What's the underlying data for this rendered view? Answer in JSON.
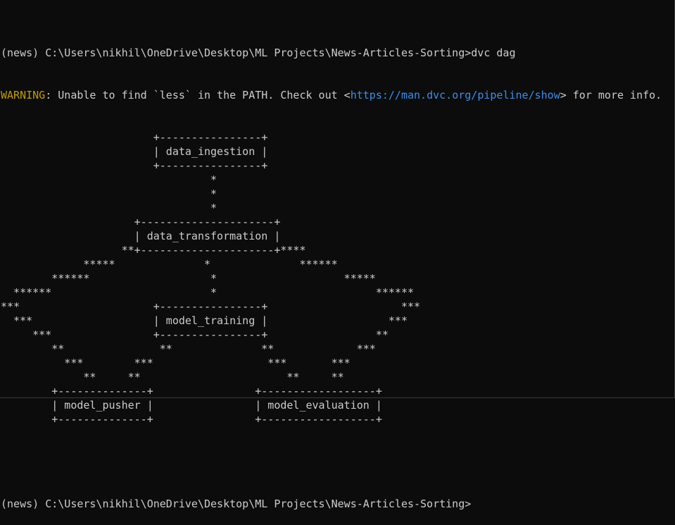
{
  "command_line": {
    "prompt": "(news) C:\\Users\\nikhil\\OneDrive\\Desktop\\ML Projects\\News-Articles-Sorting>",
    "command": "dvc dag"
  },
  "warning": {
    "label": "WARNING",
    "text_before_url": ": Unable to find `less` in the PATH. Check out <",
    "url": "https://man.dvc.org/pipeline/show",
    "text_after_url": "> for more info."
  },
  "dag": {
    "lines": [
      "                        +----------------+",
      "                        | data_ingestion |",
      "                        +----------------+",
      "                                 *",
      "                                 *",
      "                                 *",
      "                     +---------------------+",
      "                     | data_transformation |",
      "                   **+---------------------+****",
      "             *****              *              ******",
      "        ******                   *                    *****",
      "  ******                         *                         ******",
      "***                     +----------------+                     ***",
      "  ***                   | model_training |                   ***",
      "     ***                +----------------+                 **",
      "        **               **              **             ***",
      "          ***        ***                  ***       ***",
      "             **     **                       **     **",
      "        +--------------+                +------------------+",
      "        | model_pusher |                | model_evaluation |",
      "        +--------------+                +------------------+"
    ]
  },
  "final_prompt": {
    "prompt": "(news) C:\\Users\\nikhil\\OneDrive\\Desktop\\ML Projects\\News-Articles-Sorting>"
  },
  "colors": {
    "background": "#0c0c0c",
    "foreground": "#cccccc",
    "warning": "#c19c00",
    "link": "#3b8eea"
  }
}
